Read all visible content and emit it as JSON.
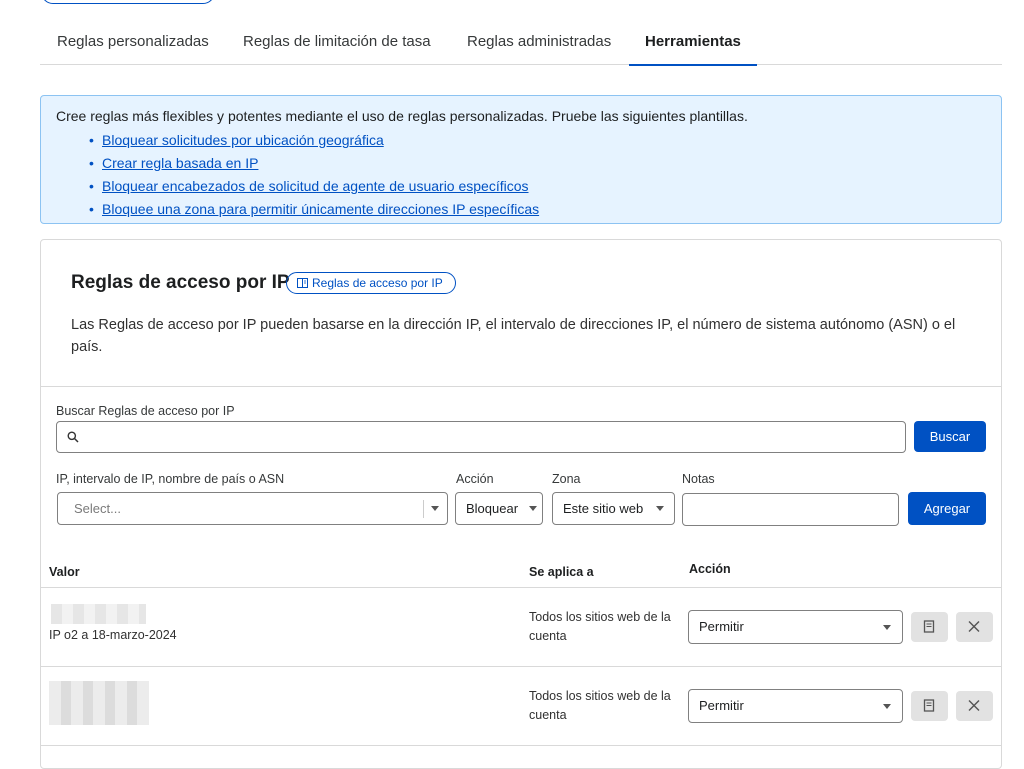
{
  "tabs": [
    {
      "label": "Reglas personalizadas"
    },
    {
      "label": "Reglas de limitación de tasa"
    },
    {
      "label": "Reglas administradas"
    },
    {
      "label": "Herramientas"
    }
  ],
  "active_tab": "Herramientas",
  "callout": {
    "text": "Cree reglas más flexibles y potentes mediante el uso de reglas personalizadas. Pruebe las siguientes plantillas.",
    "links": [
      {
        "label": "Bloquear solicitudes por ubicación geográfica"
      },
      {
        "label": "Crear regla basada en IP"
      },
      {
        "label": "Bloquear encabezados de solicitud de agente de usuario específicos"
      },
      {
        "label": "Bloquee una zona para permitir únicamente direcciones IP específicas"
      }
    ]
  },
  "ip_access": {
    "title": "Reglas de acceso por IP",
    "doc_link": "Reglas de acceso por IP",
    "description": "Las Reglas de acceso por IP pueden basarse en la dirección IP, el intervalo de direcciones IP, el número de sistema autónomo (ASN) o el país.",
    "search": {
      "label": "Buscar Reglas de acceso por IP",
      "value": "",
      "button": "Buscar"
    },
    "form": {
      "value_label": "IP, intervalo de IP, nombre de país o ASN",
      "value_placeholder": "Select...",
      "action_label": "Acción",
      "action_value": "Bloquear",
      "zone_label": "Zona",
      "zone_value": "Este sitio web",
      "notes_label": "Notas",
      "notes_value": "",
      "add_button": "Agregar"
    },
    "table": {
      "columns": [
        "Valor",
        "Se aplica a",
        "Acción"
      ],
      "rows": [
        {
          "note": "IP o2 a 18-marzo-2024",
          "scope": "Todos los sitios web de la cuenta",
          "action": "Permitir"
        },
        {
          "note": "",
          "scope": "Todos los sitios web de la cuenta",
          "action": "Permitir"
        }
      ]
    }
  },
  "colors": {
    "accent": "#0051c3",
    "callout_bg": "#e6f3ff",
    "callout_border": "#8cc3f2"
  }
}
